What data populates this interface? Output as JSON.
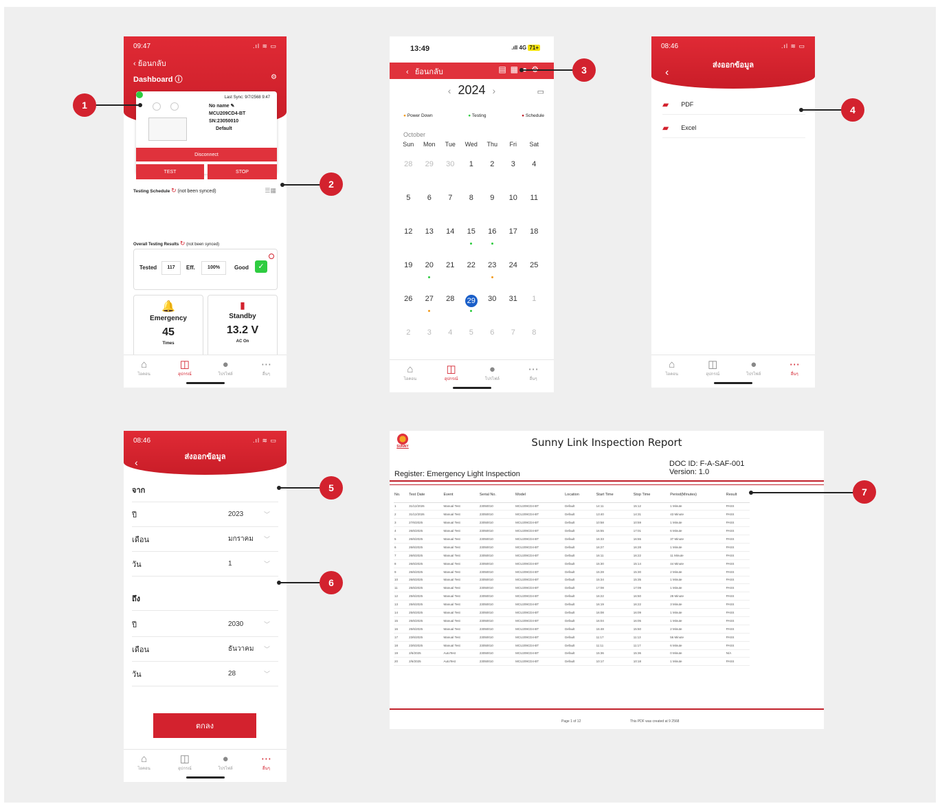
{
  "callouts": [
    "1",
    "2",
    "3",
    "4",
    "5",
    "6",
    "7"
  ],
  "phone1": {
    "time": "09:47",
    "back_label": "ย้อนกลับ",
    "title": "Dashboard ⓘ",
    "last_sync": "Last Sync: 9/7/2568 9:47",
    "device_name": "No name",
    "model": "MCU209CD4-BT",
    "serial": "SN:23050010",
    "group": "Default",
    "disconnect_label": "Disconnect",
    "test_label": "TEST",
    "stop_label": "STOP",
    "schedule_label": "Testing Schedule",
    "schedule_status": "(not been synced)",
    "results_label": "Overall Testing Results",
    "results_status": "(not been synced)",
    "tested_label": "Tested",
    "tested_value": "117",
    "eff_label": "Eff.",
    "eff_value": "100%",
    "good_label": "Good",
    "emergency_label": "Emergency",
    "emergency_value": "45",
    "emergency_unit": "Times",
    "standby_label": "Standby",
    "standby_value": "13.2 V",
    "standby_unit": "AC On"
  },
  "phone2": {
    "time": "13:49",
    "network": "4G",
    "battery": "71+",
    "back_label": "ย้อนกลับ",
    "year": "2024",
    "legend": [
      "Power Down",
      "Testing",
      "Schedule"
    ],
    "legend_colors": [
      "#f39c1f",
      "#2ecc40",
      "#c0202a"
    ],
    "month": "October",
    "weekdays": [
      "Sun",
      "Mon",
      "Tue",
      "Wed",
      "Thu",
      "Fri",
      "Sat"
    ],
    "weeks": [
      [
        "28",
        "29",
        "30",
        "1",
        "2",
        "3",
        "4"
      ],
      [
        "5",
        "6",
        "7",
        "8",
        "9",
        "10",
        "11"
      ],
      [
        "12",
        "13",
        "14",
        "15",
        "16",
        "17",
        "18"
      ],
      [
        "19",
        "20",
        "21",
        "22",
        "23",
        "24",
        "25"
      ],
      [
        "26",
        "27",
        "28",
        "29",
        "30",
        "31",
        "1"
      ],
      [
        "2",
        "3",
        "4",
        "5",
        "6",
        "7",
        "8"
      ]
    ],
    "today": "29"
  },
  "phone3": {
    "time": "08:46",
    "title": "ส่งออกข้อมูล",
    "options": [
      "PDF",
      "Excel"
    ]
  },
  "phone4": {
    "time": "08:46",
    "title": "ส่งออกข้อมูล",
    "from_label": "จาก",
    "to_label": "ถึง",
    "year_label": "ปี",
    "month_label": "เดือน",
    "day_label": "วัน",
    "from_year": "2023",
    "from_month": "มกราคม",
    "from_day": "1",
    "to_year": "2030",
    "to_month": "ธันวาคม",
    "to_day": "28",
    "ok_label": "ตกลง"
  },
  "tabs": [
    "ไอคอน",
    "อุปกรณ์",
    "โปรไฟล์",
    "อื่นๆ"
  ],
  "report": {
    "logo_text": "SUNNY",
    "title": "Sunny Link Inspection Report",
    "doc_id": "DOC ID: F-A-SAF-001",
    "version": "Version: 1.0",
    "register": "Register: Emergency Light Inspection",
    "columns": [
      "No.",
      "Test Date",
      "Event",
      "Serial No.",
      "Model",
      "Location",
      "Start Time",
      "Stop Time",
      "Period(Minutes)",
      "Result"
    ],
    "rows": [
      [
        "1",
        "31/12/2026",
        "Manual Test",
        "23050010",
        "MCU209CD4-BT",
        "Default",
        "14:11",
        "15:12",
        "1 Minute",
        "PASS"
      ],
      [
        "2",
        "31/12/2026",
        "Manual Test",
        "23050010",
        "MCU209CD4-BT",
        "Default",
        "13:40",
        "14:31",
        "43 Minute",
        "PASS"
      ],
      [
        "3",
        "27/6/2025",
        "Manual Test",
        "23050010",
        "MCU209CD4-BT",
        "Default",
        "10:58",
        "10:59",
        "1 Minute",
        "PASS"
      ],
      [
        "4",
        "26/6/2025",
        "Manual Test",
        "23050010",
        "MCU209CD4-BT",
        "Default",
        "16:55",
        "17:01",
        "6 Minute",
        "PASS"
      ],
      [
        "5",
        "26/6/2025",
        "Manual Test",
        "23050010",
        "MCU209CD4-BT",
        "Default",
        "16:33",
        "16:55",
        "37 Minute",
        "PASS"
      ],
      [
        "6",
        "26/6/2025",
        "Manual Test",
        "23050010",
        "MCU209CD4-BT",
        "Default",
        "16:27",
        "16:28",
        "1 Minute",
        "PASS"
      ],
      [
        "7",
        "26/6/2025",
        "Manual Test",
        "23050010",
        "MCU209CD4-BT",
        "Default",
        "16:11",
        "16:22",
        "11 Minute",
        "PASS"
      ],
      [
        "8",
        "26/6/2025",
        "Manual Test",
        "23050010",
        "MCU209CD4-BT",
        "Default",
        "15:30",
        "15:14",
        "44 Minute",
        "PASS"
      ],
      [
        "9",
        "26/6/2025",
        "Manual Test",
        "23050010",
        "MCU209CD4-BT",
        "Default",
        "15:28",
        "15:30",
        "2 Minute",
        "PASS"
      ],
      [
        "10",
        "26/6/2025",
        "Manual Test",
        "23050010",
        "MCU209CD4-BT",
        "Default",
        "15:34",
        "15:35",
        "1 Minute",
        "PASS"
      ],
      [
        "11",
        "25/6/2025",
        "Manual Test",
        "23050010",
        "MCU209CD4-BT",
        "Default",
        "17:08",
        "17:09",
        "1 Minute",
        "PASS"
      ],
      [
        "12",
        "25/6/2025",
        "Manual Test",
        "23050010",
        "MCU209CD4-BT",
        "Default",
        "16:22",
        "16:50",
        "28 Minute",
        "PASS"
      ],
      [
        "13",
        "25/6/2025",
        "Manual Test",
        "23050010",
        "MCU209CD4-BT",
        "Default",
        "16:19",
        "16:22",
        "3 Minute",
        "PASS"
      ],
      [
        "14",
        "25/6/2025",
        "Manual Test",
        "23050010",
        "MCU209CD4-BT",
        "Default",
        "16:08",
        "16:09",
        "1 Minute",
        "PASS"
      ],
      [
        "15",
        "25/6/2025",
        "Manual Test",
        "23050010",
        "MCU209CD4-BT",
        "Default",
        "16:04",
        "16:05",
        "1 Minute",
        "PASS"
      ],
      [
        "16",
        "25/6/2025",
        "Manual Test",
        "23050010",
        "MCU209CD4-BT",
        "Default",
        "15:48",
        "15:50",
        "2 Minute",
        "PASS"
      ],
      [
        "17",
        "23/6/2025",
        "Manual Test",
        "23050010",
        "MCU209CD4-BT",
        "Default",
        "11:17",
        "11:13",
        "56 Minute",
        "PASS"
      ],
      [
        "18",
        "23/6/2025",
        "Manual Test",
        "23050010",
        "MCU209CD4-BT",
        "Default",
        "11:11",
        "11:17",
        "6 Minute",
        "PASS"
      ],
      [
        "19",
        "2/6/2025",
        "AutoTest",
        "23050010",
        "MCU209CD4-BT",
        "Default",
        "15:36",
        "15:36",
        "0 Minute",
        "N/A"
      ],
      [
        "20",
        "2/6/2025",
        "AutoTest",
        "23050010",
        "MCU209CD4-BT",
        "Default",
        "10:17",
        "10:18",
        "1 Minute",
        "PASS"
      ]
    ],
    "page": "Page 1 of 12",
    "created": "This PDF was created at    9 2568"
  }
}
